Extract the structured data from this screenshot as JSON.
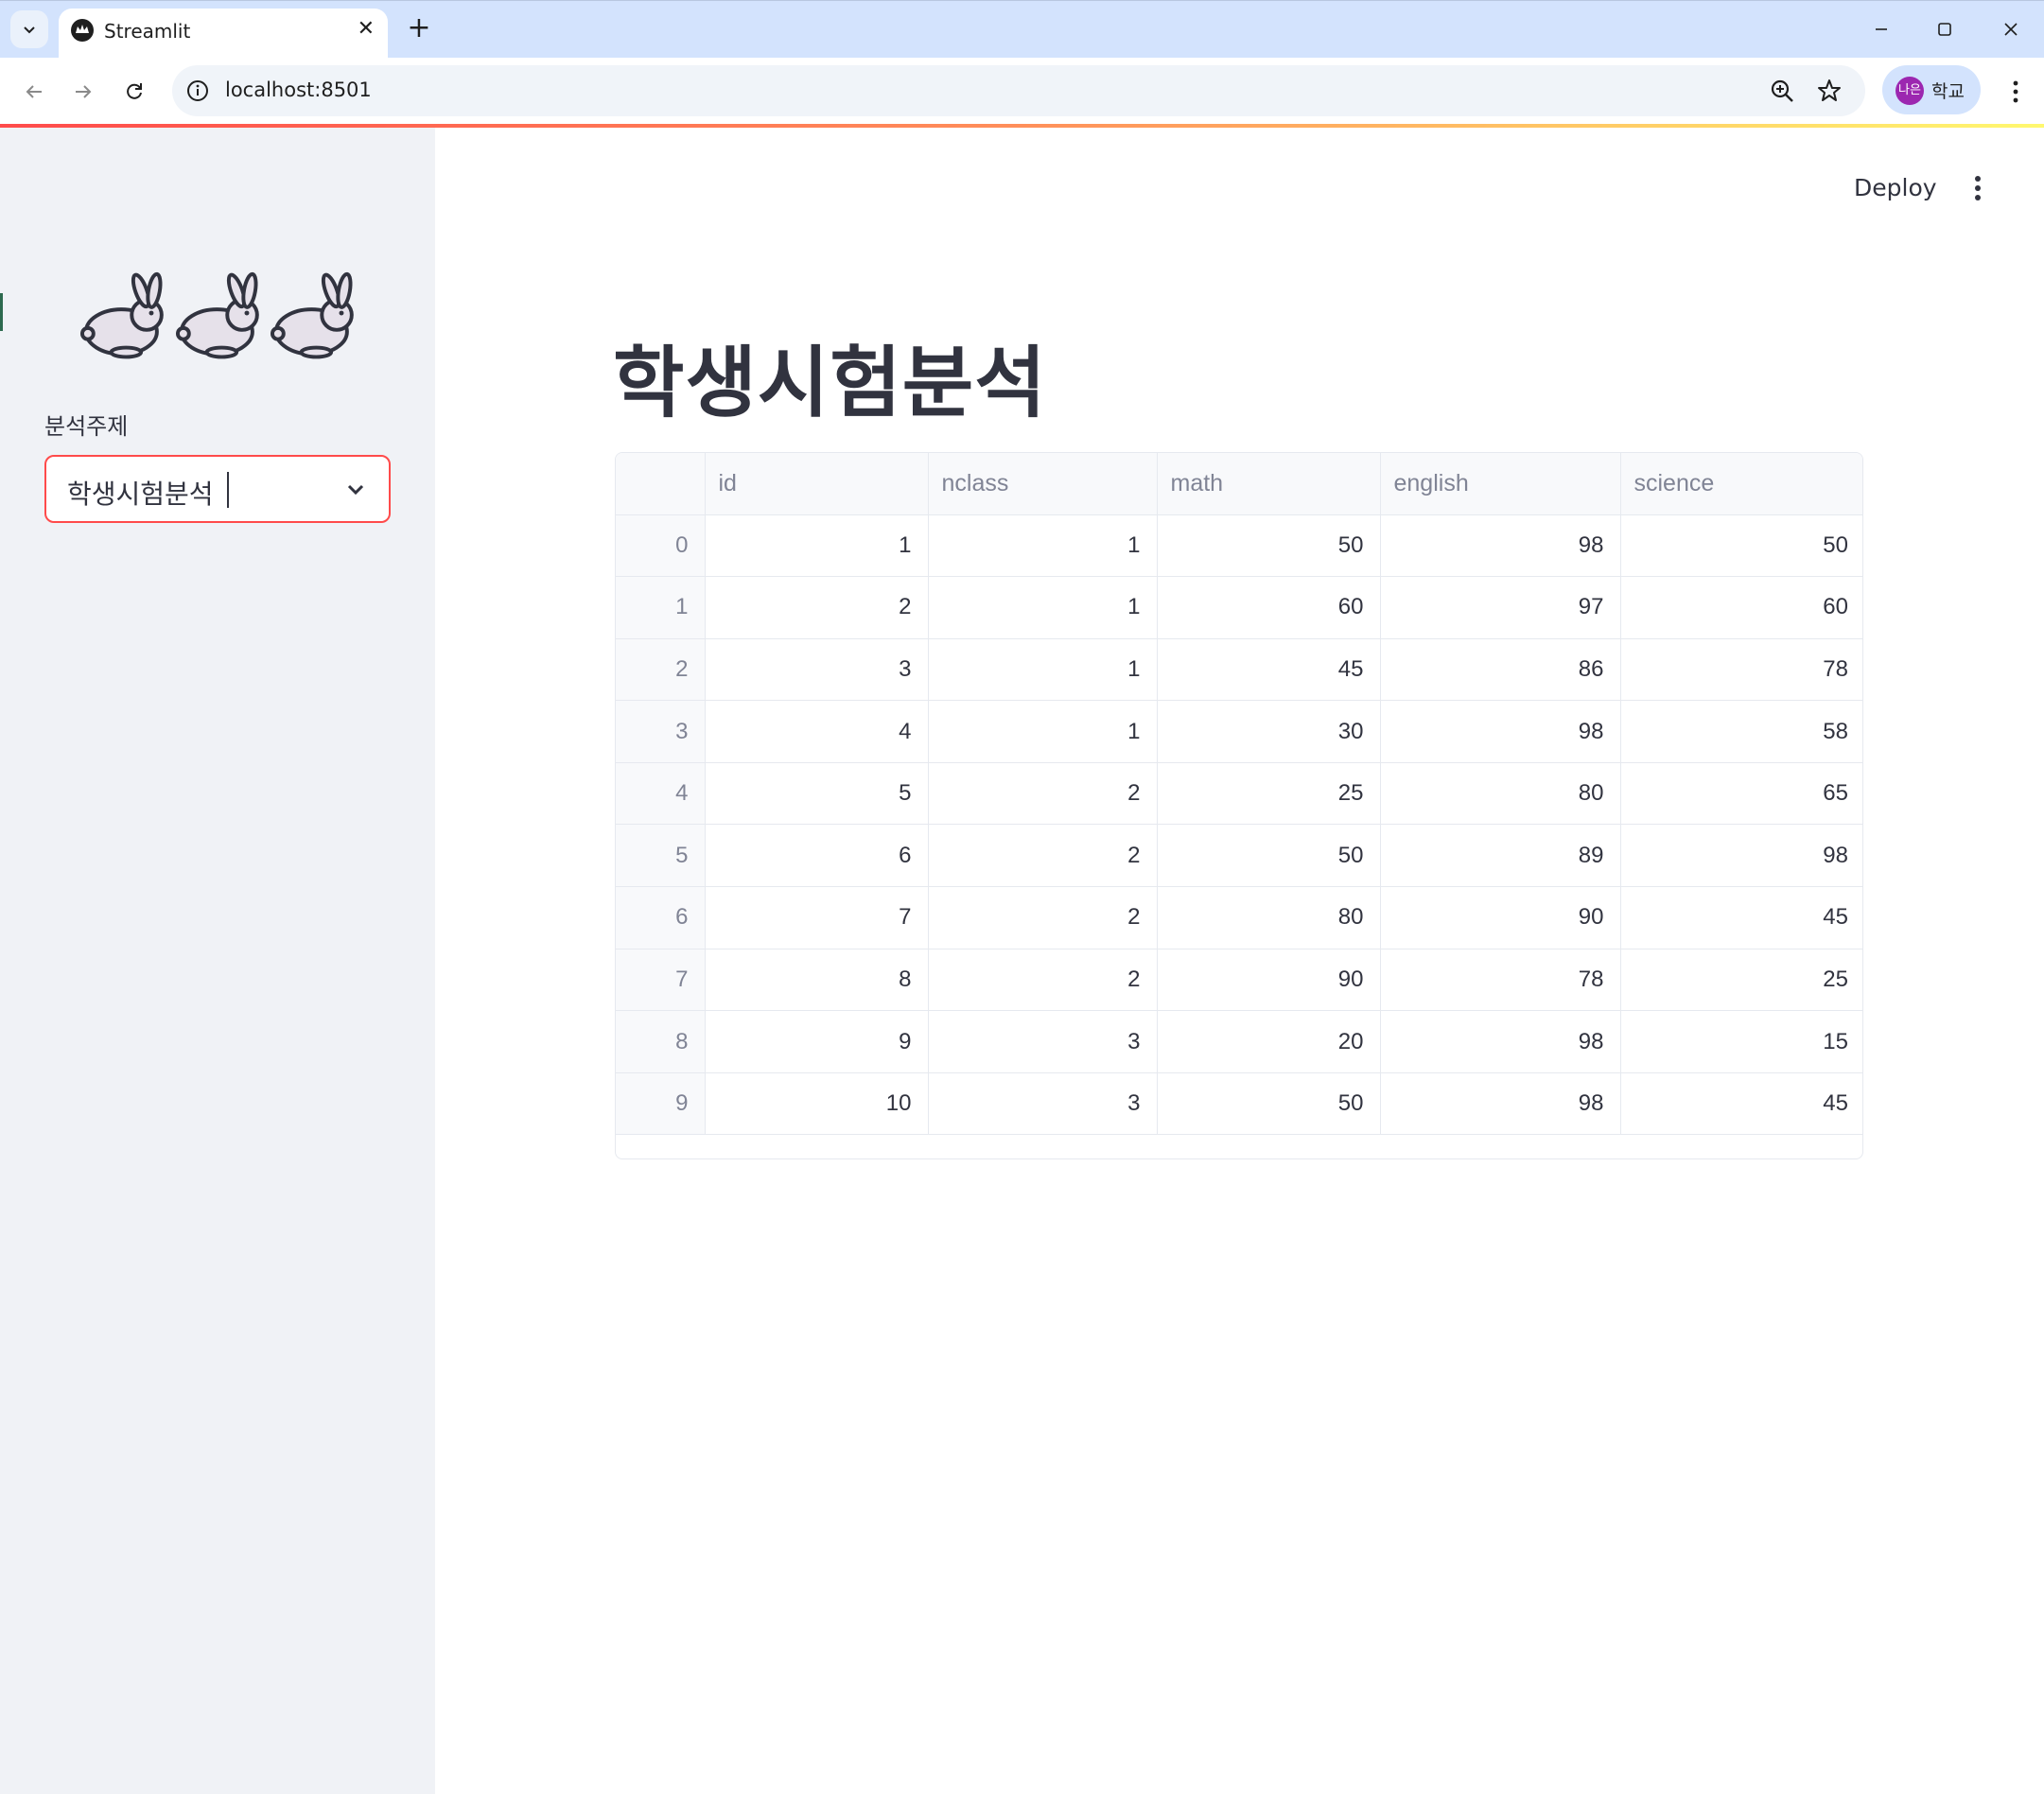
{
  "browser": {
    "tab_title": "Streamlit",
    "url": "localhost:8501",
    "profile_initials": "나은",
    "profile_name": "학교"
  },
  "app": {
    "deploy_label": "Deploy",
    "sidebar": {
      "emoji": [
        "🐇",
        "🐇",
        "🐇"
      ],
      "select_label": "분석주제",
      "select_value": "학생시험분석"
    },
    "title": "학생시험분석",
    "table": {
      "columns": [
        "",
        "id",
        "nclass",
        "math",
        "english",
        "science"
      ],
      "rows": [
        [
          "0",
          "1",
          "1",
          "50",
          "98",
          "50"
        ],
        [
          "1",
          "2",
          "1",
          "60",
          "97",
          "60"
        ],
        [
          "2",
          "3",
          "1",
          "45",
          "86",
          "78"
        ],
        [
          "3",
          "4",
          "1",
          "30",
          "98",
          "58"
        ],
        [
          "4",
          "5",
          "2",
          "25",
          "80",
          "65"
        ],
        [
          "5",
          "6",
          "2",
          "50",
          "89",
          "98"
        ],
        [
          "6",
          "7",
          "2",
          "80",
          "90",
          "45"
        ],
        [
          "7",
          "8",
          "2",
          "90",
          "78",
          "25"
        ],
        [
          "8",
          "9",
          "3",
          "20",
          "98",
          "15"
        ],
        [
          "9",
          "10",
          "3",
          "50",
          "98",
          "45"
        ]
      ]
    }
  },
  "colors": {
    "accent": "#ff4b4b",
    "sidebar_bg": "#f0f2f6",
    "text": "#31333f",
    "muted": "#808495",
    "chrome_tabstrip": "#d3e3fd"
  }
}
